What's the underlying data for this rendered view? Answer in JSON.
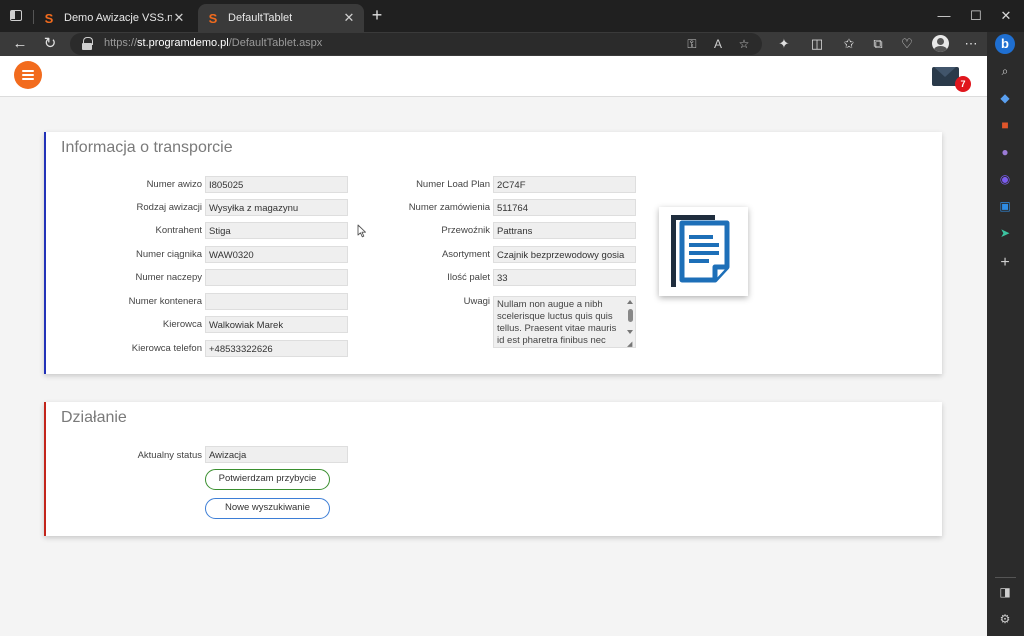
{
  "browser": {
    "tabs": [
      {
        "title": "Demo Awizacje VSS.net - Demo ..."
      },
      {
        "title": "DefaultTablet"
      }
    ],
    "url_scheme": "https://",
    "url_host": "st.programdemo.pl",
    "url_path": "/DefaultTablet.aspx"
  },
  "header": {
    "unread_count": "7"
  },
  "transport": {
    "title": "Informacja o transporcie",
    "left_fields": [
      {
        "label": "Numer awizo",
        "value": "I805025"
      },
      {
        "label": "Rodzaj awizacji",
        "value": "Wysyłka z magazynu"
      },
      {
        "label": "Kontrahent",
        "value": "Stiga"
      },
      {
        "label": "Numer ciągnika",
        "value": "WAW0320"
      },
      {
        "label": "Numer naczepy",
        "value": ""
      },
      {
        "label": "Numer kontenera",
        "value": ""
      },
      {
        "label": "Kierowca",
        "value": "Walkowiak Marek"
      },
      {
        "label": "Kierowca telefon",
        "value": "+48533322626"
      }
    ],
    "right_fields": [
      {
        "label": "Numer Load Plan",
        "value": "2C74F"
      },
      {
        "label": "Numer zamówienia",
        "value": "511764"
      },
      {
        "label": "Przewoźnik",
        "value": "Pattrans"
      },
      {
        "label": "Asortyment",
        "value": "Czajnik bezprzewodowy gosia"
      },
      {
        "label": "Ilość palet",
        "value": "33"
      }
    ],
    "notes_label": "Uwagi",
    "notes_value": "Nullam non augue a nibh scelerisque luctus quis quis tellus. Praesent vitae mauris id est pharetra finibus nec"
  },
  "action": {
    "title": "Działanie",
    "status_label": "Aktualny status",
    "status_value": "Awizacja",
    "confirm_button": "Potwierdzam przybycie",
    "new_search_button": "Nowe wyszukiwanie"
  },
  "colors": {
    "accent_orange": "#f26b1d",
    "transport_border": "#2232b8",
    "action_border": "#c3251b",
    "confirm_border": "#3a8f2f",
    "search_border": "#3d7ed6",
    "badge_red": "#e0161d",
    "doc_icon_blue": "#1d6fb8",
    "doc_icon_dark": "#1f2d3d"
  }
}
